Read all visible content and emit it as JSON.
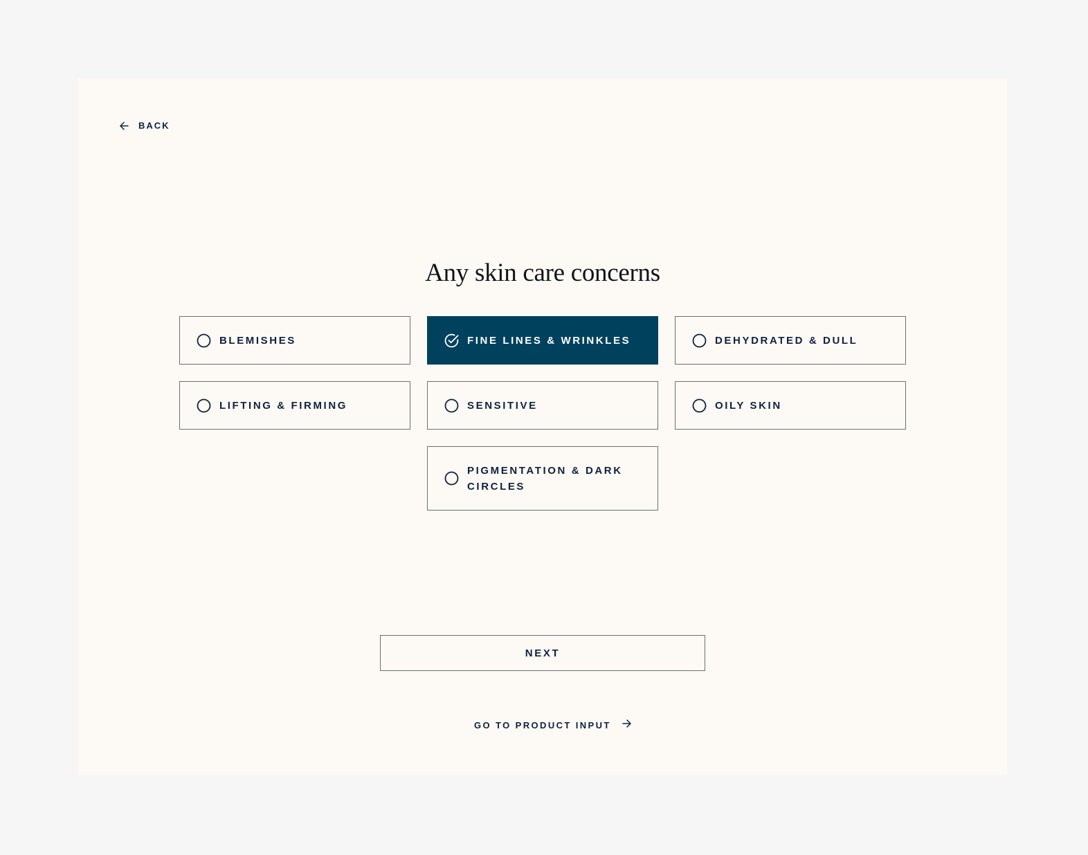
{
  "colors": {
    "page_background": "#f6f6f6",
    "card_background": "#fdfaf5",
    "accent": "#00425e",
    "text": "#0e2240",
    "border": "#6f6f6f"
  },
  "nav": {
    "back_label": "BACK",
    "back_icon": "arrow-left-icon"
  },
  "question": {
    "title": "Any skin care concerns"
  },
  "options": [
    {
      "label": "BLEMISHES",
      "selected": false,
      "icon": "radio-empty-icon"
    },
    {
      "label": "FINE LINES & WRINKLES",
      "selected": true,
      "icon": "check-circle-icon"
    },
    {
      "label": "DEHYDRATED & DULL",
      "selected": false,
      "icon": "radio-empty-icon"
    },
    {
      "label": "LIFTING & FIRMING",
      "selected": false,
      "icon": "radio-empty-icon"
    },
    {
      "label": "SENSITIVE",
      "selected": false,
      "icon": "radio-empty-icon"
    },
    {
      "label": "OILY SKIN",
      "selected": false,
      "icon": "radio-empty-icon"
    },
    {
      "label": "PIGMENTATION & DARK CIRCLES",
      "selected": false,
      "icon": "radio-empty-icon"
    }
  ],
  "actions": {
    "next_label": "NEXT",
    "product_input_label": "GO TO PRODUCT INPUT",
    "product_input_icon": "arrow-right-icon"
  }
}
